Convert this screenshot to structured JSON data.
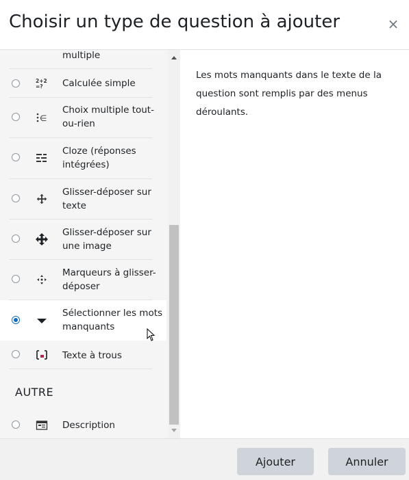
{
  "dialog": {
    "title": "Choisir un type de question à ajouter",
    "close_symbol": "×"
  },
  "list": {
    "items": [
      {
        "label": "multiple",
        "icon": "multiple-choice-icon",
        "selected": false
      },
      {
        "label": "Calculée simple",
        "icon": "calculated-simple-icon",
        "selected": false
      },
      {
        "label": "Choix multiple tout-ou-rien",
        "icon": "all-or-nothing-icon",
        "selected": false
      },
      {
        "label": "Cloze (réponses intégrées)",
        "icon": "cloze-icon",
        "selected": false
      },
      {
        "label": "Glisser-déposer sur texte",
        "icon": "drag-drop-text-icon",
        "selected": false
      },
      {
        "label": "Glisser-déposer sur une image",
        "icon": "drag-drop-image-icon",
        "selected": false
      },
      {
        "label": "Marqueurs à glisser-déposer",
        "icon": "drag-drop-markers-icon",
        "selected": false
      },
      {
        "label": "Sélectionner les mots manquants",
        "icon": "select-missing-words-icon",
        "selected": true
      },
      {
        "label": "Texte à trous",
        "icon": "gapfill-icon",
        "selected": false
      }
    ],
    "section_other": "AUTRE",
    "other_items": [
      {
        "label": "Description",
        "icon": "description-icon",
        "selected": false
      }
    ]
  },
  "description": {
    "text": "Les mots manquants dans le texte de la question sont remplis par des menus déroulants."
  },
  "footer": {
    "add_label": "Ajouter",
    "cancel_label": "Annuler"
  },
  "colors": {
    "accent": "#0f6cbf",
    "button_bg": "#ced4da",
    "list_bg": "#f5f5f5"
  }
}
